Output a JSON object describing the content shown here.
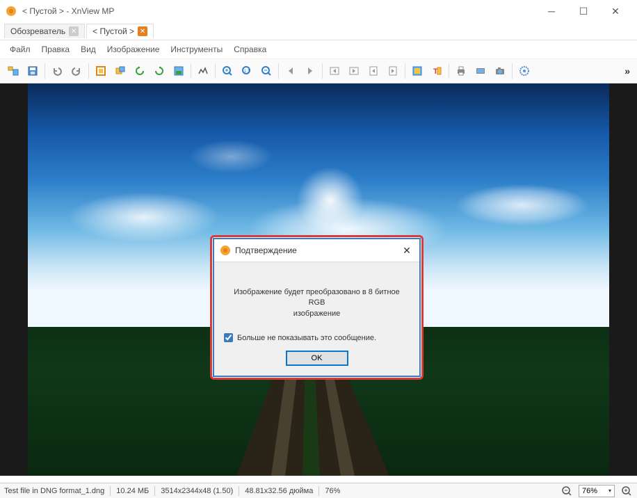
{
  "window": {
    "title": "< Пустой > - XnView MP"
  },
  "tabs": [
    {
      "label": "Обозреватель",
      "active": false,
      "close_style": "gray"
    },
    {
      "label": "< Пустой >",
      "active": true,
      "close_style": "orange"
    }
  ],
  "menu": [
    "Файл",
    "Правка",
    "Вид",
    "Изображение",
    "Инструменты",
    "Справка"
  ],
  "toolbar_icons": [
    "browser-icon",
    "save-icon",
    "sep",
    "undo-icon",
    "redo-icon",
    "sep",
    "fit-icon",
    "rotate-ccw-icon",
    "rotate-left-icon",
    "rotate-right-icon",
    "crop-icon",
    "sep",
    "levels-icon",
    "sep",
    "zoom-in-icon",
    "zoom-100-icon",
    "zoom-out-icon",
    "sep",
    "prev-icon",
    "next-icon",
    "sep",
    "first-icon",
    "last-icon",
    "page-prev-icon",
    "page-next-icon",
    "sep",
    "fullscreen-icon",
    "text-icon",
    "sep",
    "print-icon",
    "scan-icon",
    "camera-icon",
    "sep",
    "settings-icon",
    "more"
  ],
  "dialog": {
    "title": "Подтверждение",
    "message_line1": "Изображение будет преобразовано в 8 битное RGB",
    "message_line2": "изображение",
    "checkbox_label": "Больше не показывать это сообщение.",
    "ok_label": "OK"
  },
  "status": {
    "filename": "Test file in DNG format_1.dng",
    "size": "10.24 МБ",
    "dimensions": "3514x2344x48 (1.50)",
    "print_size": "48.81x32.56 дюйма",
    "zoom_text": "76%",
    "zoom_value": "76%"
  }
}
